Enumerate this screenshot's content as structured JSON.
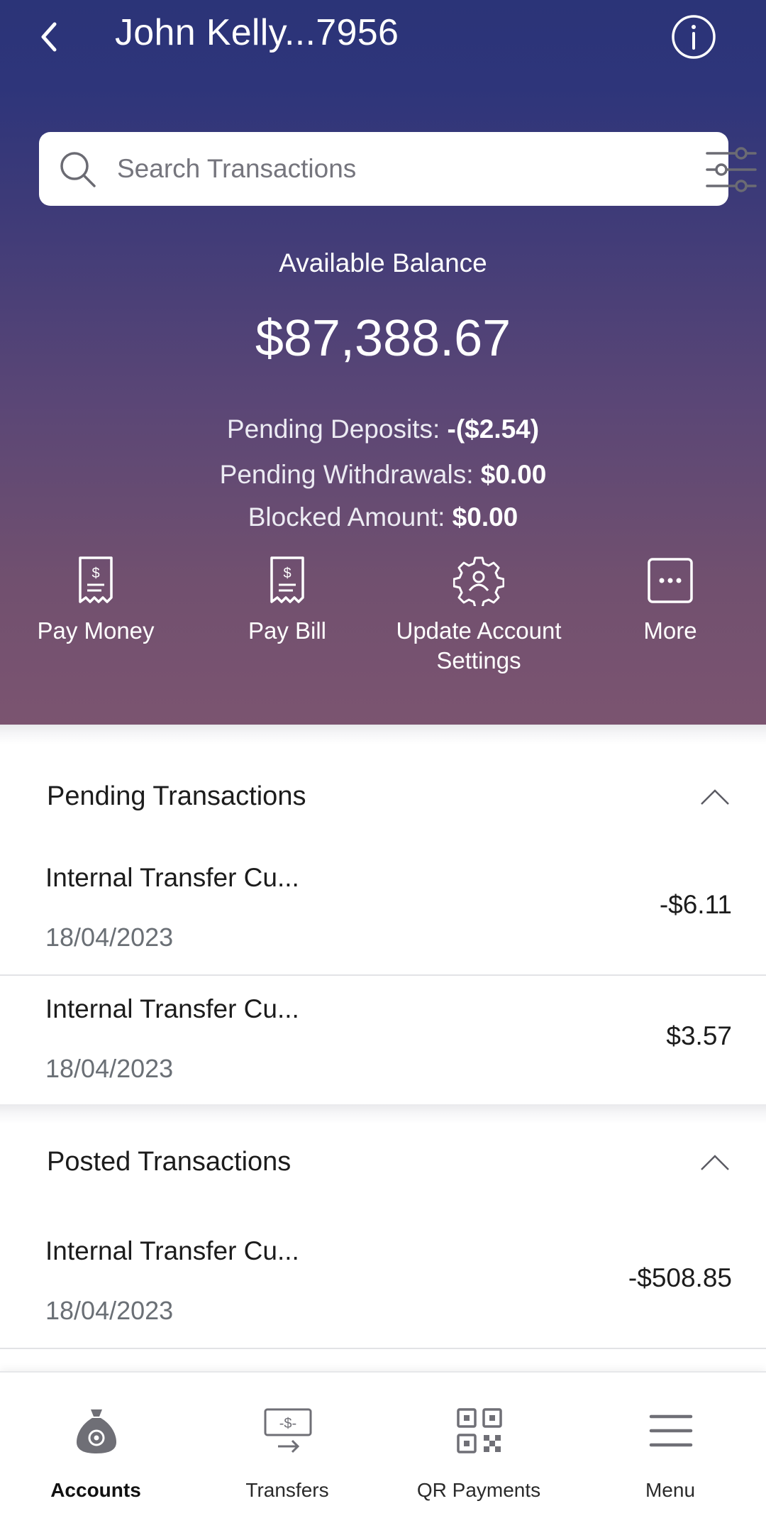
{
  "header": {
    "title": "John Kelly...7956"
  },
  "search": {
    "placeholder": "Search Transactions"
  },
  "balance": {
    "label": "Available Balance",
    "value": "$87,388.67"
  },
  "details": {
    "pending_deposits_label": "Pending Deposits: ",
    "pending_deposits_value": "-($2.54)",
    "pending_withdrawals_label": "Pending Withdrawals: ",
    "pending_withdrawals_value": "$0.00",
    "blocked_label": "Blocked Amount: ",
    "blocked_value": "$0.00"
  },
  "actions": [
    {
      "label": "Pay Money",
      "icon": "receipt-dollar-icon"
    },
    {
      "label": "Pay Bill",
      "icon": "receipt-dollar-icon"
    },
    {
      "label_line1": "Update Account",
      "label_line2": "Settings",
      "icon": "gear-user-icon"
    },
    {
      "label": "More",
      "icon": "more-dots-icon"
    }
  ],
  "pending": {
    "title": "Pending Transactions",
    "items": [
      {
        "name": "Internal Transfer Cu...",
        "date": "18/04/2023",
        "amount": "-$6.11"
      },
      {
        "name": "Internal Transfer Cu...",
        "date": "18/04/2023",
        "amount": "$3.57"
      }
    ]
  },
  "posted": {
    "title": "Posted Transactions",
    "items": [
      {
        "name": "Internal Transfer Cu...",
        "date": "18/04/2023",
        "amount": "-$508.85"
      }
    ]
  },
  "nav": {
    "items": [
      {
        "label": "Accounts",
        "icon": "money-bag-icon",
        "active": true
      },
      {
        "label": "Transfers",
        "icon": "transfer-icon",
        "active": false
      },
      {
        "label": "QR Payments",
        "icon": "qr-code-icon",
        "active": false
      },
      {
        "label": "Menu",
        "icon": "hamburger-menu-icon",
        "active": false
      }
    ]
  },
  "colors": {
    "header_top": "#2b3478",
    "header_bottom": "#7b5470",
    "text_primary": "#1c1c1c",
    "date_gray": "#6a6f75"
  }
}
